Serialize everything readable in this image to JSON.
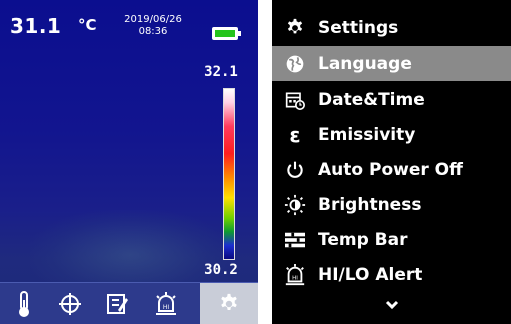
{
  "camera": {
    "temperature": "31.1",
    "temperature_unit": "°C",
    "date": "2019/06/26",
    "time": "08:36",
    "battery_icon": "battery-full-icon",
    "scale_max": "32.1",
    "scale_min": "30.2",
    "toolbar": [
      {
        "icon": "thermometer-icon",
        "active": false
      },
      {
        "icon": "crosshair-icon",
        "active": false
      },
      {
        "icon": "palette-icon",
        "active": false
      },
      {
        "icon": "alarm-icon",
        "active": false
      },
      {
        "icon": "gear-icon",
        "active": true
      }
    ],
    "colors": {
      "battery": "#25c41b",
      "toolbar_bg": "#2d3a8c",
      "active_tool_bg": "#c9cdd8"
    }
  },
  "settings": {
    "title": "Settings",
    "items": [
      {
        "label": "Language",
        "icon": "globe-icon",
        "selected": true
      },
      {
        "label": "Date&Time",
        "icon": "calendar-clock-icon",
        "selected": false
      },
      {
        "label": "Emissivity",
        "icon": "epsilon-icon",
        "selected": false
      },
      {
        "label": "Auto Power Off",
        "icon": "power-icon",
        "selected": false
      },
      {
        "label": "Brightness",
        "icon": "brightness-icon",
        "selected": false
      },
      {
        "label": "Temp Bar",
        "icon": "temp-bar-icon",
        "selected": false
      },
      {
        "label": "HI/LO Alert",
        "icon": "alarm-icon",
        "selected": false
      }
    ],
    "more_icon": "chevron-down-icon",
    "colors": {
      "selected_bg": "#8a8a8a",
      "bg": "#000000"
    }
  }
}
